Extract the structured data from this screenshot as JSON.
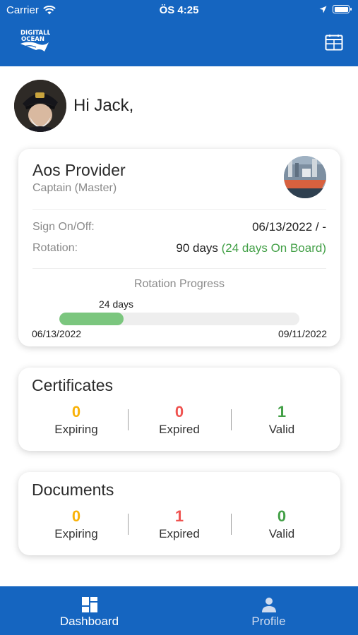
{
  "status_bar": {
    "carrier": "Carrier",
    "time": "ÖS 4:25"
  },
  "header": {
    "logo_text": "DigitAll Ocean",
    "logo_line1": "DIGITALL",
    "logo_line2": "OCEAN",
    "calendar_icon": "calendar-icon"
  },
  "greeting": {
    "text": "Hi Jack,"
  },
  "rotation_card": {
    "name": "Aos Provider",
    "role": "Captain (Master)",
    "sign_label": "Sign On/Off:",
    "sign_value": "06/13/2022 / -",
    "rotation_label": "Rotation:",
    "rotation_days": "90 days",
    "on_board": "(24 days On Board)",
    "progress_title": "Rotation Progress",
    "progress_days": "24 days",
    "progress_fraction": 0.267,
    "start_date": "06/13/2022",
    "end_date": "09/11/2022"
  },
  "certificates": {
    "title": "Certificates",
    "expiring": "0",
    "expiring_label": "Expiring",
    "expired": "0",
    "expired_label": "Expired",
    "valid": "1",
    "valid_label": "Valid"
  },
  "documents": {
    "title": "Documents",
    "expiring": "0",
    "expiring_label": "Expiring",
    "expired": "1",
    "expired_label": "Expired",
    "valid": "0",
    "valid_label": "Valid"
  },
  "tabs": {
    "dashboard": {
      "label": "Dashboard",
      "icon": "dashboard-icon"
    },
    "profile": {
      "label": "Profile",
      "icon": "person-icon"
    }
  },
  "colors": {
    "primary": "#1565c0",
    "expiring": "#f9b208",
    "expired": "#ef5350",
    "valid": "#43a047",
    "progress": "#7bc67e"
  }
}
